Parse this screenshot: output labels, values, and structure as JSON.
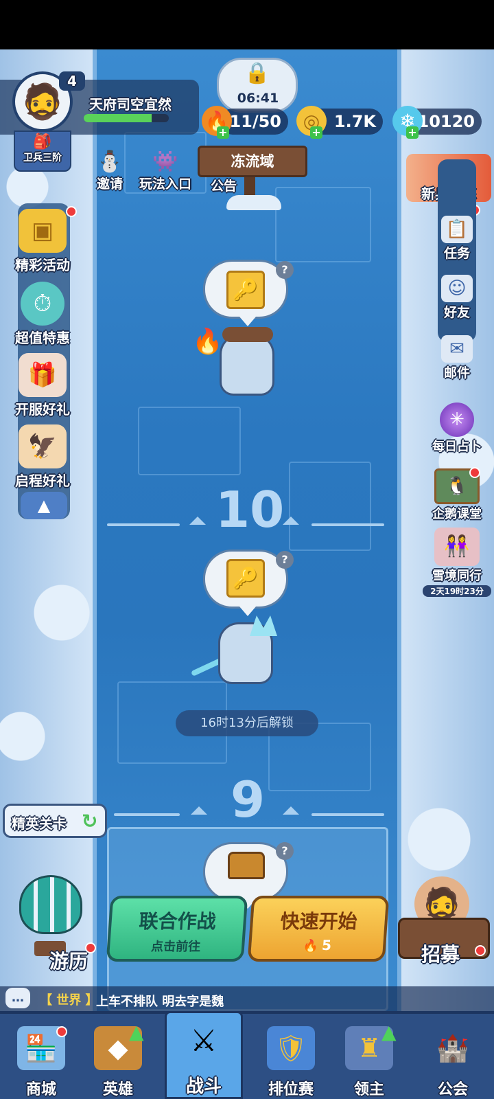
{
  "player": {
    "level": "4",
    "name": "天府司空宜然",
    "rank": "卫兵三阶",
    "exp_fraction": 0.8
  },
  "timer": "06:41",
  "resources": {
    "stamina": "11/50",
    "gold": "1.7K",
    "gems": "10120"
  },
  "top_actions": {
    "invite": "邀请",
    "gameplay": "玩法入口",
    "notice": "公告",
    "region_sign": "冻流域"
  },
  "left_menu": [
    {
      "label": "精彩活动",
      "icon": "treasure-frame-icon"
    },
    {
      "label": "超值特惠",
      "icon": "clock-offer-icon"
    },
    {
      "label": "开服好礼",
      "icon": "gift-girl-icon"
    },
    {
      "label": "启程好礼",
      "icon": "griffin-icon"
    }
  ],
  "right_menu": {
    "trial": "新兵试炼",
    "tasks": "任务",
    "friends": "好友",
    "mail": "邮件",
    "daily": "每日占卜",
    "class": "企鹅课堂",
    "snow_event": "雪境同行",
    "snow_event_timer": "2天19时23分"
  },
  "stages": {
    "floor_upper": "10",
    "floor_lower": "9",
    "unlock_text": "16时13分后解锁",
    "qmark": "?"
  },
  "elite": "精英关卡",
  "journey": "游历",
  "recruit": "招募",
  "buttons": {
    "coop_title": "联合作战",
    "coop_sub": "点击前往",
    "quick_title": "快速开始",
    "quick_cost": "5"
  },
  "chat": {
    "channel": "【 世界 】",
    "message": "上车不排队  明去字是魏"
  },
  "nav": [
    {
      "label": "商城",
      "icon": "shop-icon"
    },
    {
      "label": "英雄",
      "icon": "hero-card-icon"
    },
    {
      "label": "战斗",
      "icon": "crossed-swords-icon"
    },
    {
      "label": "排位赛",
      "icon": "rank-shield-icon"
    },
    {
      "label": "领主",
      "icon": "banner-icon"
    },
    {
      "label": "公会",
      "icon": "guild-castle-icon"
    }
  ],
  "colors": {
    "river": "#2b78c0",
    "coop_button": "#3fcf9a",
    "quick_button": "#f3b63b",
    "nav_bg": "#2d4f84"
  }
}
